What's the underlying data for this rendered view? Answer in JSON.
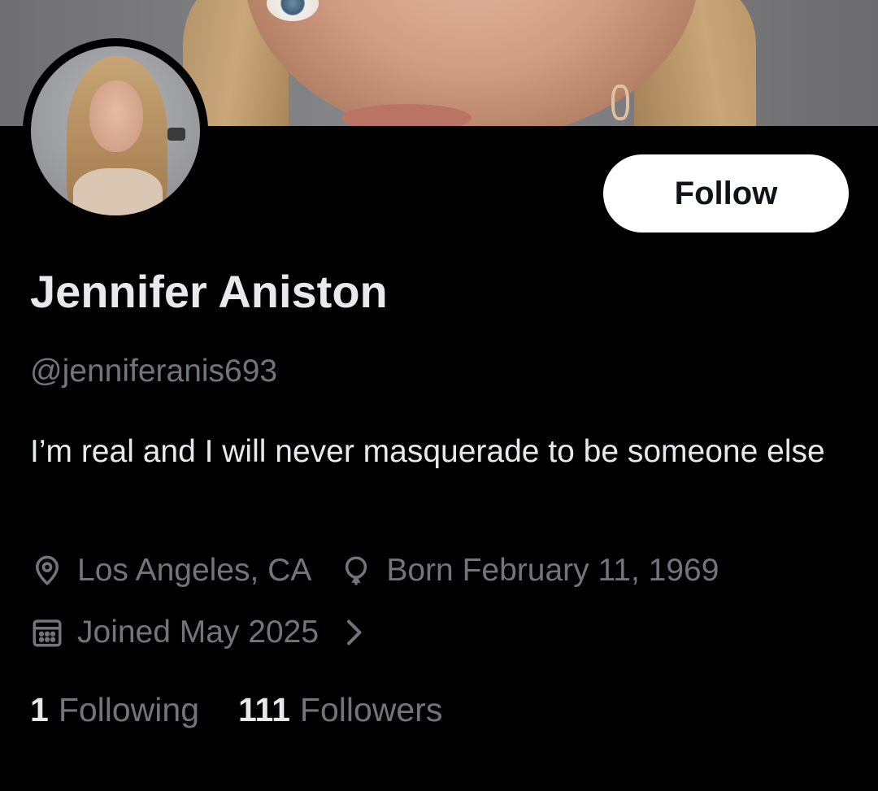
{
  "profile": {
    "name": "Jennifer Aniston",
    "handle": "@jenniferanis693",
    "bio": "I’m real and I will never masquerade to be someone else",
    "location": "Los Angeles, CA",
    "birthday": "Born February 11, 1969",
    "joined": "Joined May 2025",
    "follow_label": "Follow"
  },
  "stats": {
    "following_count": "1",
    "following_label": "Following",
    "followers_count": "111",
    "followers_label": "Followers"
  },
  "icons": {
    "location": "location-pin-icon",
    "birthday": "balloon-icon",
    "joined": "calendar-icon",
    "more": "chevron-right-icon"
  },
  "colors": {
    "background": "#000000",
    "primary_text": "#e7e9ea",
    "secondary_text": "#71767b",
    "button_bg": "#ffffff",
    "button_text": "#0f1419"
  }
}
